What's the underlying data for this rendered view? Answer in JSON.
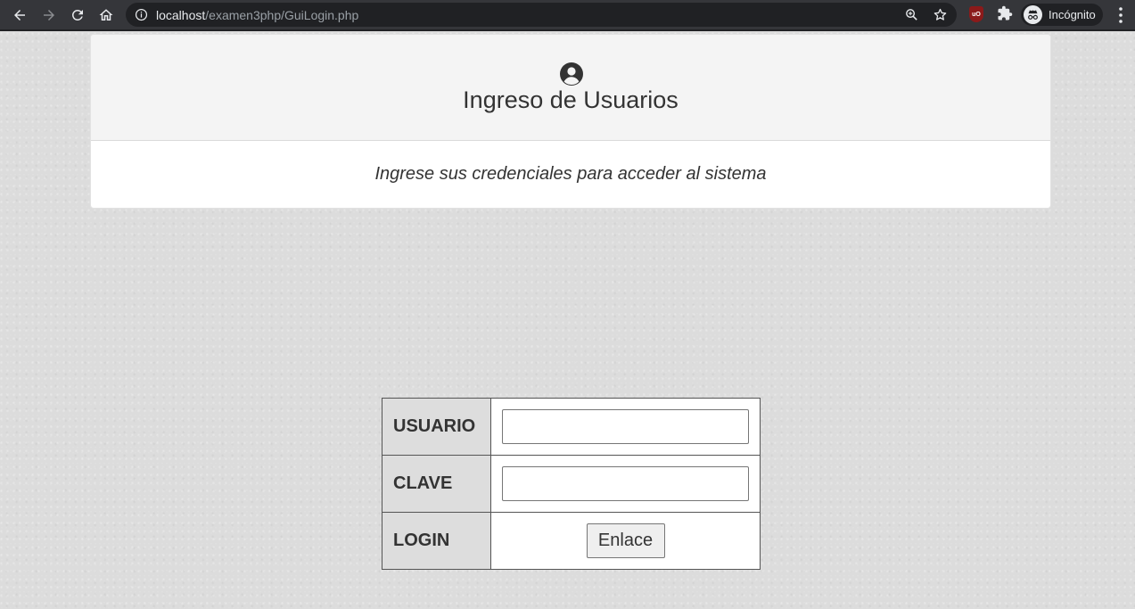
{
  "browser": {
    "url_host": "localhost",
    "url_path": "/examen3php/GuiLogin.php",
    "incognito_label": "Incógnito",
    "ublock_label": "uO"
  },
  "header": {
    "icon": "user-circle-icon",
    "title": "Ingreso de Usuarios",
    "subtitle": "Ingrese sus credenciales para acceder al sistema"
  },
  "login_form": {
    "usuario_label": "USUARIO",
    "usuario_value": "",
    "clave_label": "CLAVE",
    "clave_value": "",
    "login_label": "LOGIN",
    "button_label": "Enlace"
  }
}
